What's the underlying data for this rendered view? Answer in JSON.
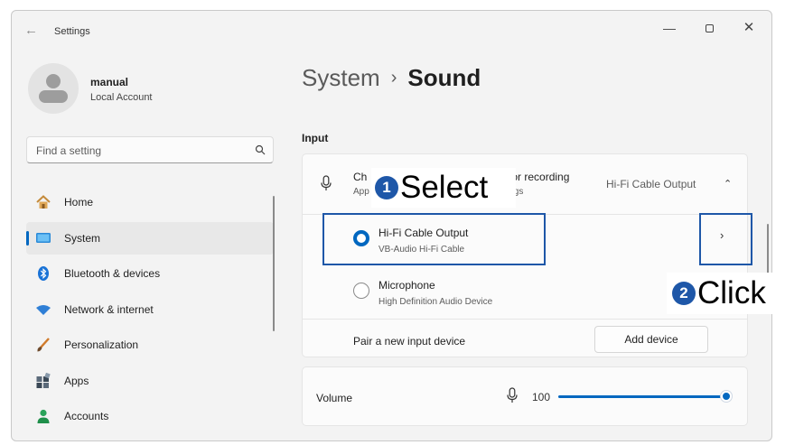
{
  "window": {
    "back_glyph": "←",
    "title": "Settings",
    "minimize_glyph": "—",
    "close_glyph": "✕"
  },
  "user": {
    "name": "manual",
    "account_type": "Local Account"
  },
  "search": {
    "placeholder": "Find a setting"
  },
  "sidebar": {
    "items": [
      {
        "label": "Home",
        "icon": "home-icon",
        "active": false
      },
      {
        "label": "System",
        "icon": "system-monitor-icon",
        "active": true
      },
      {
        "label": "Bluetooth & devices",
        "icon": "bluetooth-icon",
        "active": false
      },
      {
        "label": "Network & internet",
        "icon": "wifi-icon",
        "active": false
      },
      {
        "label": "Personalization",
        "icon": "brush-icon",
        "active": false
      },
      {
        "label": "Apps",
        "icon": "apps-icon",
        "active": false
      },
      {
        "label": "Accounts",
        "icon": "person-icon",
        "active": false
      }
    ]
  },
  "breadcrumb": {
    "parent": "System",
    "separator": "›",
    "current": "Sound"
  },
  "input": {
    "section_label": "Input",
    "choose_title_start": "Ch",
    "choose_title_end": "or recording",
    "choose_desc_start": "App",
    "choose_desc_end": "gs",
    "current_device": "Hi-Fi Cable Output",
    "collapse_glyph": "⌃",
    "devices": [
      {
        "name": "Hi-Fi Cable Output",
        "sub": "VB-Audio Hi-Fi Cable",
        "selected": true
      },
      {
        "name": "Microphone",
        "sub": "High Definition Audio Device",
        "selected": false
      }
    ],
    "arrow_glyph": "›",
    "pair_label": "Pair a new input device",
    "add_button": "Add device"
  },
  "volume": {
    "label": "Volume",
    "value_text": "100",
    "level_percent": 100
  },
  "annotations": {
    "select": {
      "number": "1",
      "text": "Select"
    },
    "click": {
      "number": "2",
      "text": "Click"
    }
  },
  "colors": {
    "accent": "#0067c0",
    "annotation_blue": "#1e57a8"
  }
}
